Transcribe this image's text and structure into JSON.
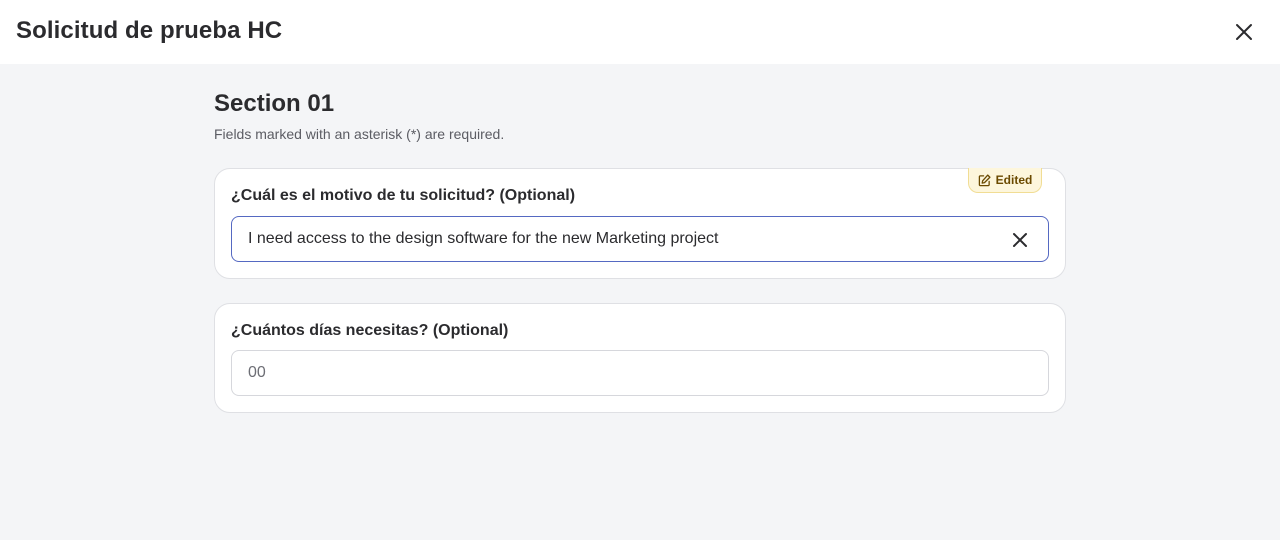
{
  "header": {
    "title": "Solicitud de prueba HC",
    "close_icon": "close-icon"
  },
  "section": {
    "title": "Section 01",
    "hint": "Fields marked with an asterisk (*) are required."
  },
  "questions": [
    {
      "label": "¿Cuál es el motivo de tu solicitud? (Optional)",
      "value": "I need access to the design software for the new Marketing project",
      "placeholder": "",
      "badge": "Edited",
      "badge_icon": "edit-icon",
      "clear_icon": "clear-icon"
    },
    {
      "label": "¿Cuántos días necesitas? (Optional)",
      "value": "",
      "placeholder": "00"
    }
  ],
  "colors": {
    "page_bg": "#f4f5f7",
    "header_bg": "#ffffff",
    "focus_border": "#5569c2",
    "badge_bg": "#fdf6dc",
    "badge_text": "#6b4a00"
  }
}
